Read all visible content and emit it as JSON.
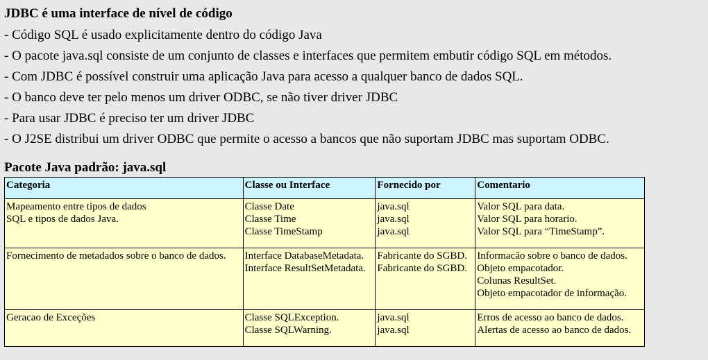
{
  "section1": {
    "title": "JDBC é uma interface de nível de código",
    "bullets": [
      "- Código SQL é usado explicitamente dentro do código Java",
      "- O pacote java.sql consiste de um conjunto de classes e interfaces que permitem embutir código SQL em métodos.",
      "- Com JDBC é possível construir uma aplicação Java para acesso a qualquer banco de dados SQL.",
      "- O banco deve ter pelo menos um driver ODBC, se não tiver driver JDBC",
      "- Para usar JDBC é preciso ter um driver JDBC",
      "- O J2SE distribui um driver ODBC que permite o acesso a bancos que não suportam JDBC mas suportam ODBC."
    ]
  },
  "section2": {
    "title": "Pacote Java padrão: java.sql"
  },
  "table": {
    "headers": [
      "Categoria",
      "Classe ou Interface",
      "Fornecido por",
      "Comentario"
    ],
    "rows": [
      {
        "categoria": [
          "Mapeamento entre tipos de dados",
          "SQL e tipos de dados Java."
        ],
        "classe": [
          "Classe Date",
          "Classe Time",
          "Classe TimeStamp"
        ],
        "fornecido": [
          "java.sql",
          "java.sql",
          "java.sql"
        ],
        "comentario": [
          "Valor SQL para data.",
          "Valor SQL para horario.",
          "Valor SQL para “TimeStamp”."
        ]
      },
      {
        "categoria": [
          "Fornecimento de metadados sobre o banco de dados."
        ],
        "classe": [
          "Interface DatabaseMetadata.",
          "Interface ResultSetMetadata."
        ],
        "fornecido": [
          "Fabricante do SGBD.",
          "Fabricante do SGBD."
        ],
        "comentario": [
          "Informacão sobre o banco de dados.",
          "Objeto empacotador.",
          "Colunas ResultSet.",
          "Objeto empacotador de informação."
        ]
      },
      {
        "categoria": [
          "Geracao de Exceções"
        ],
        "classe": [
          "Classe SQLException.",
          "Classe SQLWarning."
        ],
        "fornecido": [
          "java.sql",
          "java.sql"
        ],
        "comentario": [
          "Erros de acesso ao banco de dados.",
          "Alertas de acesso ao banco de dados."
        ]
      }
    ]
  }
}
